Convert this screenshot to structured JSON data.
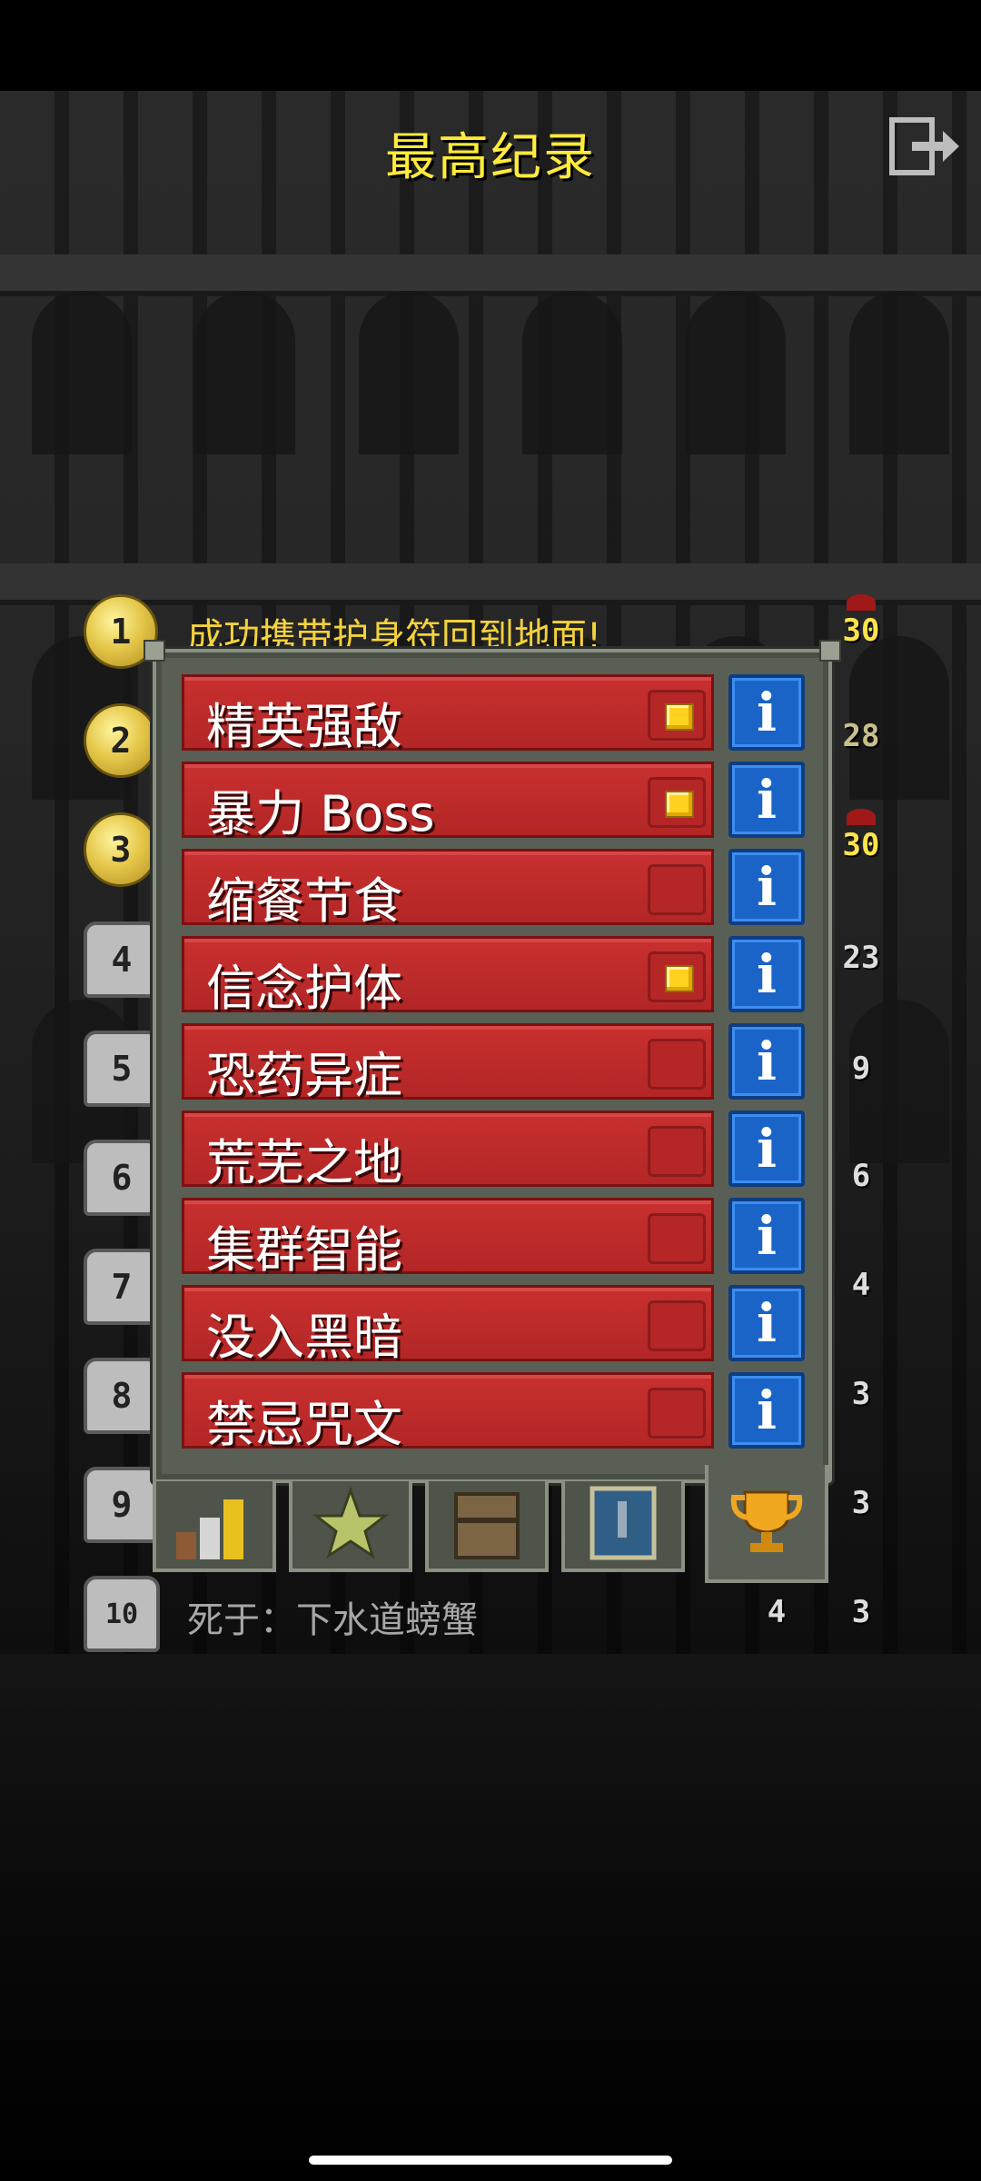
{
  "title": "最高纪录",
  "exit_icon": "exit-icon",
  "top_record_text": "成功携带护身符回到地面!",
  "last_record_text": "死于：下水道螃蟹",
  "ranks": [
    "1",
    "2",
    "3",
    "4",
    "5",
    "6",
    "7",
    "8",
    "9",
    "10"
  ],
  "right_markers": [
    "30",
    "28",
    "30",
    "23",
    "9",
    "6",
    "4",
    "3",
    "3",
    "3"
  ],
  "last_row_level": "4",
  "challenges": [
    {
      "label": "精英强敌",
      "checked": true
    },
    {
      "label": "暴力 Boss",
      "checked": true
    },
    {
      "label": "缩餐节食",
      "checked": false
    },
    {
      "label": "信念护体",
      "checked": true
    },
    {
      "label": "恐药异症",
      "checked": false
    },
    {
      "label": "荒芜之地",
      "checked": false
    },
    {
      "label": "集群智能",
      "checked": false
    },
    {
      "label": "没入黑暗",
      "checked": false
    },
    {
      "label": "禁忌咒文",
      "checked": false
    }
  ],
  "info_label": "i",
  "tabs": [
    "stats-icon",
    "badges-icon",
    "chest-icon",
    "journal-icon",
    "trophy-icon"
  ],
  "colors": {
    "title": "#ffeb3b",
    "challenge_red": "#c8302f",
    "info_blue": "#1a64c8",
    "check_yellow": "#ffd21f"
  }
}
